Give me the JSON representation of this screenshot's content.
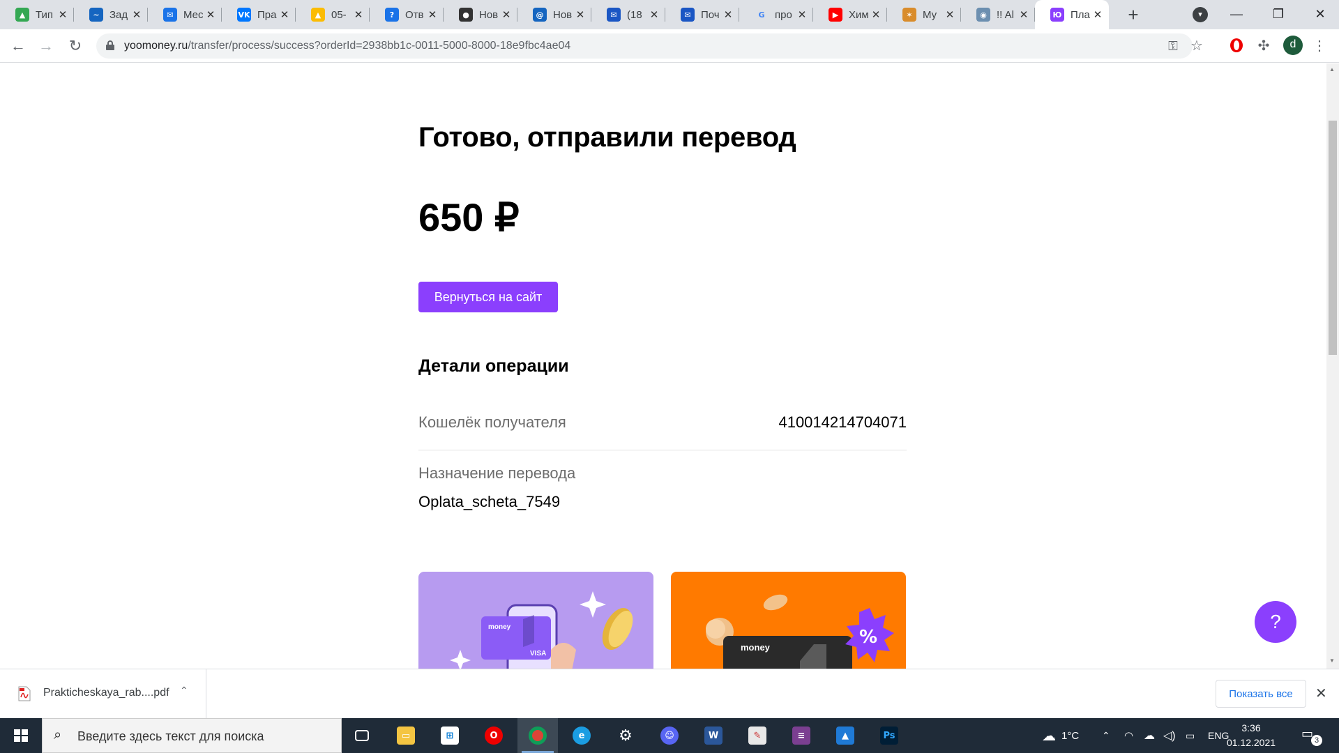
{
  "browser": {
    "tabs": [
      {
        "title": "Тип",
        "icon": "google-drive-icon",
        "color": "#34a853",
        "glyph": "▲"
      },
      {
        "title": "Зад",
        "icon": "task-app-icon",
        "color": "#1565c0",
        "glyph": "~"
      },
      {
        "title": "Мес",
        "icon": "messenger-icon",
        "color": "#1a73e8",
        "glyph": "✉"
      },
      {
        "title": "Пра",
        "icon": "vk-icon",
        "color": "#0077ff",
        "glyph": "VK"
      },
      {
        "title": "05-",
        "icon": "google-drive-icon",
        "color": "#fbbc04",
        "glyph": "▲"
      },
      {
        "title": "Отв",
        "icon": "answers-icon",
        "color": "#1a73e8",
        "glyph": "?"
      },
      {
        "title": "Нов",
        "icon": "github-icon",
        "color": "#333333",
        "glyph": "●"
      },
      {
        "title": "Нов",
        "icon": "mail-at-icon",
        "color": "#1565c0",
        "glyph": "@"
      },
      {
        "title": "(18",
        "icon": "mail-icon",
        "color": "#1a56c4",
        "glyph": "✉"
      },
      {
        "title": "Поч",
        "icon": "mail-icon",
        "color": "#1a56c4",
        "glyph": "✉"
      },
      {
        "title": "про",
        "icon": "google-icon",
        "color": "#ffffff",
        "glyph": "G"
      },
      {
        "title": "Хим",
        "icon": "youtube-icon",
        "color": "#ff0000",
        "glyph": "▶"
      },
      {
        "title": "Му",
        "icon": "music-icon",
        "color": "#d98c2b",
        "glyph": "✶"
      },
      {
        "title": "!! Al",
        "icon": "globe-icon",
        "color": "#6c8fb0",
        "glyph": "◉"
      },
      {
        "title": "Пла",
        "icon": "yoomoney-icon",
        "color": "#8b3ffd",
        "glyph": "Ю"
      }
    ],
    "active_tab_index": 14,
    "url_host": "yoomoney.ru",
    "url_path": "/transfer/process/success?orderId=2938bb1c-0011-5000-8000-18e9fbc4ae04",
    "profile_initial": "d"
  },
  "page": {
    "heading": "Готово, отправили перевод",
    "amount": "650 ₽",
    "back_button": "Вернуться на сайт",
    "details_title": "Детали операции",
    "wallet_label": "Кошелёк получателя",
    "wallet_value": "410014214704071",
    "purpose_label": "Назначение перевода",
    "purpose_value": "Oplata_scheta_7549",
    "promo_brand": "money",
    "promo_card_label": "VISA",
    "help_button": "?"
  },
  "downloads": {
    "file_name": "Prakticheskaya_rab....pdf",
    "show_all": "Показать все"
  },
  "taskbar": {
    "search_placeholder": "Введите здесь текст для поиска",
    "weather": "1°C",
    "language": "ENG",
    "time": "3:36",
    "date": "01.12.2021",
    "notifications": "3"
  },
  "colors": {
    "accent": "#8b3ffd",
    "promo_purple": "#b79bf0",
    "promo_orange": "#ff7a00"
  }
}
